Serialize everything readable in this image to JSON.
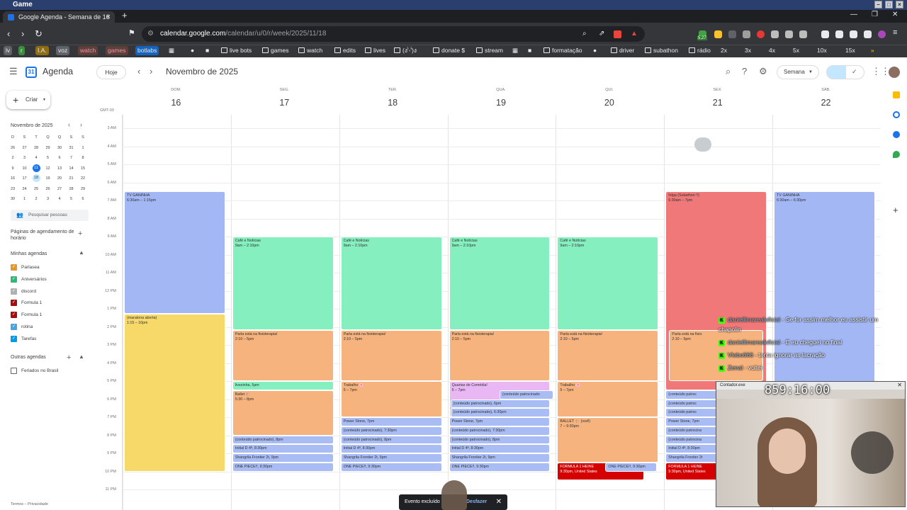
{
  "window": {
    "title": "Game"
  },
  "browser": {
    "tab_title": "Google Agenda - Semana de 16",
    "url_host": "calendar.google.com",
    "url_path": "/calendar/u/0/r/week/2025/11/18",
    "ext_badge": "5,27",
    "bookmarks": [
      "lv",
      "r",
      "I.A.",
      "voz",
      "watch",
      "games",
      "botlabs",
      "live bots",
      "games",
      "watch",
      "edits",
      "lives",
      "(ง'̀-'́)ง",
      "donate $",
      "stream",
      "formatação",
      "driver",
      "subathon",
      "rádio",
      "2x",
      "3x",
      "4x",
      "5x",
      "10x",
      "15x"
    ]
  },
  "header": {
    "app_name": "Agenda",
    "today_label": "Hoje",
    "month_title": "Novembro de 2025",
    "view_label": "Semana"
  },
  "sidebar": {
    "create_label": "Criar",
    "mini_month": "Novembro de 2025",
    "weekday_initials": [
      "D",
      "S",
      "T",
      "Q",
      "Q",
      "S",
      "S"
    ],
    "mini_weeks": [
      [
        "26",
        "27",
        "28",
        "29",
        "30",
        "31",
        "1"
      ],
      [
        "2",
        "3",
        "4",
        "5",
        "6",
        "7",
        "8"
      ],
      [
        "9",
        "10",
        "11",
        "12",
        "13",
        "14",
        "15"
      ],
      [
        "16",
        "17",
        "18",
        "19",
        "20",
        "21",
        "22"
      ],
      [
        "23",
        "24",
        "25",
        "26",
        "27",
        "28",
        "29"
      ],
      [
        "30",
        "1",
        "2",
        "3",
        "4",
        "5",
        "6"
      ]
    ],
    "search_people": "Pesquisar pessoas",
    "booking_pages": "Páginas de agendamento de horário",
    "my_calendars_title": "Minhas agendas",
    "my_calendars": [
      {
        "name": "Parlasea",
        "color": "#e09a2b"
      },
      {
        "name": "Aniversários",
        "color": "#33b679"
      },
      {
        "name": "discord",
        "color": "#b0b0b0"
      },
      {
        "name": "Formula 1",
        "color": "#a50e0e"
      },
      {
        "name": "Formula 1",
        "color": "#a50e0e"
      },
      {
        "name": "rotina",
        "color": "#4aa3df"
      },
      {
        "name": "Tarefas",
        "color": "#039be5"
      }
    ],
    "other_calendars_title": "Outras agendas",
    "other_calendars": [
      {
        "name": "Feriados no Brasil",
        "color": "#ffffff"
      }
    ],
    "footer": "Termos – Privacidade"
  },
  "week": {
    "timezone": "GMT-03",
    "days": [
      {
        "name": "DOM.",
        "num": "16"
      },
      {
        "name": "SEG.",
        "num": "17"
      },
      {
        "name": "TER.",
        "num": "18"
      },
      {
        "name": "QUA.",
        "num": "19"
      },
      {
        "name": "QUI.",
        "num": "20"
      },
      {
        "name": "SEX.",
        "num": "21"
      },
      {
        "name": "SÁB.",
        "num": "22"
      }
    ],
    "hours": [
      "3 AM",
      "4 AM",
      "5 AM",
      "6 AM",
      "7 AM",
      "8 AM",
      "9 AM",
      "10 AM",
      "11 AM",
      "12 PM",
      "1 PM",
      "2 PM",
      "3 PM",
      "4 PM",
      "5 PM",
      "6 PM",
      "7 PM",
      "8 PM",
      "9 PM",
      "10 PM",
      "11 PM"
    ]
  },
  "events": [
    {
      "day": 0,
      "start": 6.5,
      "end": 13.25,
      "title": "TV GANINHA",
      "time": "6:30am – 1:15pm",
      "color": "blue"
    },
    {
      "day": 0,
      "start": 13.25,
      "end": 22.0,
      "title": "(maratona aberta)",
      "time": "1:15 – 10pm",
      "color": "yellow"
    },
    {
      "day": 1,
      "start": 9,
      "end": 14.17,
      "title": "Café e Notícias",
      "time": "9am – 2:10pm",
      "color": "green"
    },
    {
      "day": 1,
      "start": 14.17,
      "end": 17.0,
      "title": "Parla está na fisioterapia!",
      "time": "2:10 – 5pm",
      "color": "orange"
    },
    {
      "day": 1,
      "start": 17,
      "end": 17.5,
      "title": "livezinha, 5pm",
      "time": "",
      "color": "green"
    },
    {
      "day": 1,
      "start": 17.5,
      "end": 20.0,
      "title": "Ballet 🩰",
      "time": "5:30 – 8pm",
      "color": "orange"
    },
    {
      "day": 1,
      "start": 20,
      "end": 20.5,
      "title": "(conteúdo patrocinado), 8pm",
      "time": "",
      "color": "lblue"
    },
    {
      "day": 1,
      "start": 20.5,
      "end": 21.0,
      "title": "Initial D 4ª, 8:30pm",
      "time": "",
      "color": "lblue"
    },
    {
      "day": 1,
      "start": 21,
      "end": 21.5,
      "title": "Shangrila Frontier 2t, 9pm",
      "time": "",
      "color": "lblue"
    },
    {
      "day": 1,
      "start": 21.5,
      "end": 22.0,
      "title": "ONE PIECE!!, 9:30pm",
      "time": "",
      "color": "lblue"
    },
    {
      "day": 2,
      "start": 9,
      "end": 14.17,
      "title": "Café e Notícias",
      "time": "9am – 2:10pm",
      "color": "green"
    },
    {
      "day": 2,
      "start": 14.17,
      "end": 17.0,
      "title": "Parla está na fisioterapia!",
      "time": "2:10 – 5pm",
      "color": "orange"
    },
    {
      "day": 2,
      "start": 17,
      "end": 19.0,
      "title": "Trabalho 🌸",
      "time": "5 – 7pm",
      "color": "orange"
    },
    {
      "day": 2,
      "start": 19,
      "end": 19.5,
      "title": "Power Stone, 7pm",
      "time": "",
      "color": "lblue"
    },
    {
      "day": 2,
      "start": 19.5,
      "end": 20.0,
      "title": "(conteúdo patrocinado), 7:30pm",
      "time": "",
      "color": "lblue"
    },
    {
      "day": 2,
      "start": 20,
      "end": 20.5,
      "title": "(conteúdo patrocinado), 8pm",
      "time": "",
      "color": "lblue"
    },
    {
      "day": 2,
      "start": 20.5,
      "end": 21.0,
      "title": "Initial D 4ª, 8:30pm",
      "time": "",
      "color": "lblue"
    },
    {
      "day": 2,
      "start": 21,
      "end": 21.5,
      "title": "Shangrila Frontier 2t, 9pm",
      "time": "",
      "color": "lblue"
    },
    {
      "day": 2,
      "start": 21.5,
      "end": 22.0,
      "title": "ONE PIECE!!, 9:30pm",
      "time": "",
      "color": "lblue"
    },
    {
      "day": 3,
      "start": 9,
      "end": 14.17,
      "title": "Café e Notícias",
      "time": "9am – 2:10pm",
      "color": "green"
    },
    {
      "day": 3,
      "start": 14.17,
      "end": 17.0,
      "title": "Parla está na fisioterapia!",
      "time": "2:10 – 5pm",
      "color": "orange"
    },
    {
      "day": 3,
      "start": 17,
      "end": 19.0,
      "title": "Quartas de Comédia!",
      "time": "5 – 7pm",
      "color": "pink"
    },
    {
      "day": 3,
      "start": 17.5,
      "end": 18.0,
      "title": "(conteúdo patrocinado",
      "time": "",
      "color": "lblue",
      "col": "half"
    },
    {
      "day": 3,
      "start": 18,
      "end": 18.5,
      "title": "(conteúdo patrocinado), 6pm",
      "time": "",
      "color": "lblue",
      "col": "right"
    },
    {
      "day": 3,
      "start": 18.5,
      "end": 19.0,
      "title": "(conteúdo patrocinado), 6:30pm",
      "time": "",
      "color": "lblue",
      "col": "right"
    },
    {
      "day": 3,
      "start": 19,
      "end": 19.5,
      "title": "Power Stone, 7pm",
      "time": "",
      "color": "lblue"
    },
    {
      "day": 3,
      "start": 19.5,
      "end": 20.0,
      "title": "(conteúdo patrocinado), 7:30pm",
      "time": "",
      "color": "lblue"
    },
    {
      "day": 3,
      "start": 20,
      "end": 20.5,
      "title": "(conteúdo patrocinado), 8pm",
      "time": "",
      "color": "lblue"
    },
    {
      "day": 3,
      "start": 20.5,
      "end": 21.0,
      "title": "Initial D 4ª, 8:30pm",
      "time": "",
      "color": "lblue"
    },
    {
      "day": 3,
      "start": 21,
      "end": 21.5,
      "title": "Shangrila Frontier 2t, 9pm",
      "time": "",
      "color": "lblue"
    },
    {
      "day": 3,
      "start": 21.5,
      "end": 22.0,
      "title": "ONE PIECE!!, 9:30pm",
      "time": "",
      "color": "lblue"
    },
    {
      "day": 4,
      "start": 9,
      "end": 14.17,
      "title": "Café e Notícias",
      "time": "9am – 2:10pm",
      "color": "green"
    },
    {
      "day": 4,
      "start": 14.17,
      "end": 17.0,
      "title": "Parla está na fisioterapia!",
      "time": "2:10 – 5pm",
      "color": "orange"
    },
    {
      "day": 4,
      "start": 17,
      "end": 19.0,
      "title": "Trabalho 🌸",
      "time": "5 – 7pm",
      "color": "orange"
    },
    {
      "day": 4,
      "start": 19,
      "end": 21.5,
      "title": "BALLET 🩰 (vod!)",
      "time": "7 – 9:30pm",
      "color": "orange"
    },
    {
      "day": 4,
      "start": 21.5,
      "end": 22.5,
      "title": "FORMULA 1 HEINE",
      "time": "9:30pm, United States",
      "color": "crimson",
      "col": "left"
    },
    {
      "day": 4,
      "start": 21.5,
      "end": 22.0,
      "title": "ONE PIECE!!, 9:30pm",
      "time": "",
      "color": "lblue",
      "col": "right"
    },
    {
      "day": 5,
      "start": 6.5,
      "end": 17.5,
      "title": "folga (Subathon !!)",
      "time": "6:30am – 7pm",
      "color": "red"
    },
    {
      "day": 5,
      "start": 14.17,
      "end": 17.0,
      "title": "Parla está na fisio",
      "time": "2:10 – 5pm",
      "color": "orange",
      "col": "right"
    },
    {
      "day": 5,
      "start": 17.5,
      "end": 18.0,
      "title": "(conteúdo patroc",
      "time": "",
      "color": "lblue"
    },
    {
      "day": 5,
      "start": 18,
      "end": 18.5,
      "title": "(conteúdo patroc",
      "time": "",
      "color": "lblue"
    },
    {
      "day": 5,
      "start": 18.5,
      "end": 19.0,
      "title": "(conteúdo patroc",
      "time": "",
      "color": "lblue"
    },
    {
      "day": 5,
      "start": 19,
      "end": 19.5,
      "title": "Power Stone, 7pm",
      "time": "",
      "color": "lblue"
    },
    {
      "day": 5,
      "start": 19.5,
      "end": 20.0,
      "title": "(conteúdo patrocina",
      "time": "",
      "color": "lblue"
    },
    {
      "day": 5,
      "start": 20,
      "end": 20.5,
      "title": "(conteúdo patrocina",
      "time": "",
      "color": "lblue"
    },
    {
      "day": 5,
      "start": 20.5,
      "end": 21.0,
      "title": "Initial D 4ª, 8:30pm",
      "time": "",
      "color": "lblue"
    },
    {
      "day": 5,
      "start": 21,
      "end": 21.5,
      "title": "Shangrila Frontier 2t",
      "time": "",
      "color": "lblue"
    },
    {
      "day": 5,
      "start": 21.5,
      "end": 22.5,
      "title": "FORMULA 1 HEINE",
      "time": "9:30pm, United States",
      "color": "crimson"
    },
    {
      "day": 6,
      "start": 6.5,
      "end": 17.5,
      "title": "TV GANINHA",
      "time": "6:30am – 6:30pm",
      "color": "blue"
    }
  ],
  "toast": {
    "text": "Evento excluído",
    "action": "Desfazer"
  },
  "overlay": {
    "chat": [
      {
        "user": "daniellimarealoficial",
        "msg": "Se for assim melhor eu assistir um chapolin"
      },
      {
        "user": "daniellimarealoficial",
        "msg": "E eu cheguei no final"
      },
      {
        "user": "Vlebo666",
        "msg": "tenta ignorar as lacração"
      },
      {
        "user": "Zenal",
        "msg": "voltei"
      }
    ],
    "cam_window_title": "Contador.exe",
    "timer": "859:16:00"
  }
}
